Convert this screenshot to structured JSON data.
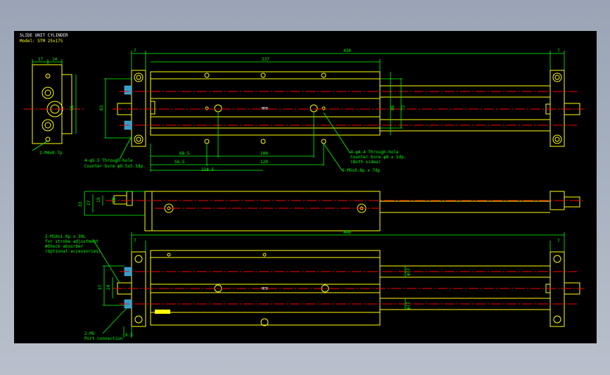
{
  "title_block": {
    "title": "SLIDE UNIT CYLINDER",
    "model": "Model: STM 25x175"
  },
  "dims": {
    "side_17": "17",
    "side_14": "14",
    "side_65": "65",
    "top_7l": "7",
    "top_237": "237",
    "top_430": "430",
    "top_7r": "7",
    "top_h63": "63",
    "top_h86": "86",
    "top_h73": "73",
    "top_685": "68.5",
    "top_100": "100",
    "top_565": "56.5",
    "top_120": "120",
    "top_1185": "118.5",
    "mid_33": "33",
    "mid_27": "27",
    "mid_19": "19",
    "mid_16": "16",
    "bot_448": "448",
    "bot_7l": "7",
    "bot_7r": "7",
    "bot_37": "37",
    "bot_24": "24",
    "bot_phi12a": "φ12",
    "bot_phi12b": "φ12",
    "bot_65": "6.5"
  },
  "notes": {
    "n_tap": "2-M4x0.7p",
    "n_cb1": "4-φ5.5 Through-hole",
    "n_cb2": "Counter bore φ9.5x5.5dp.",
    "n_th1": "4-φ4.4 Through-hole",
    "n_th2": "Counter bore φ8 x 5dp.",
    "n_th3": "(Both sides)",
    "n_m5": "6-M5x0.8p x 7dp",
    "n_adj1": "2-M10x1.0p x 30L",
    "n_adj2": "for stroke adjustment",
    "n_adj3": "#Shock absorber",
    "n_adj4": "(Optional accessories)",
    "n_port1": "2-M5",
    "n_port2": "Port connection",
    "center_top": "MPB",
    "center_bot": "MPB"
  }
}
